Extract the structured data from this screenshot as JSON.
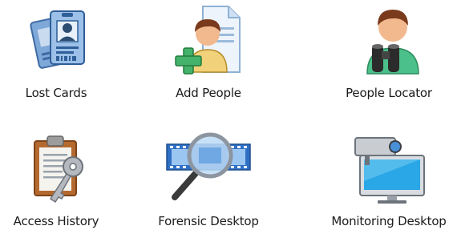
{
  "tiles": [
    {
      "label": "Lost Cards",
      "icon": "id-cards-icon"
    },
    {
      "label": "Add People",
      "icon": "add-person-document-icon"
    },
    {
      "label": "People Locator",
      "icon": "person-binoculars-icon"
    },
    {
      "label": "Access History",
      "icon": "clipboard-key-icon"
    },
    {
      "label": "Forensic Desktop",
      "icon": "filmstrip-magnifier-icon"
    },
    {
      "label": "Monitoring Desktop",
      "icon": "camera-monitor-icon"
    }
  ],
  "colors": {
    "label_text": "#1b1b1b",
    "icon_blue": "#3f7fc0",
    "icon_green": "#45b26b",
    "skin": "#f2b98f",
    "hair": "#7a3a1c"
  }
}
